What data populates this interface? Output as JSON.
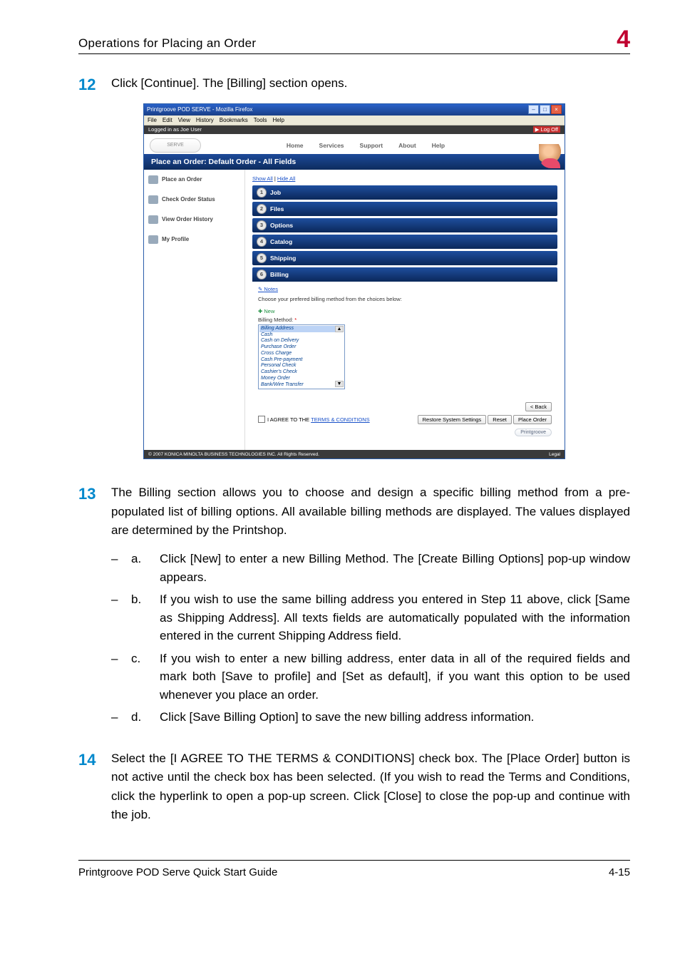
{
  "header": {
    "running_title": "Operations for Placing an Order",
    "chapter": "4"
  },
  "steps": [
    {
      "num": "12",
      "text": "Click [Continue]. The [Billing] section opens."
    },
    {
      "num": "13",
      "text": "The Billing section allows you to choose and design a specific billing method from a pre-populated list of billing options. All available billing methods are displayed. The values displayed are determined by the Printshop.",
      "subs": [
        {
          "letter": "a.",
          "text": "Click [New] to enter a new Billing Method. The [Create Billing Options] pop-up window appears."
        },
        {
          "letter": "b.",
          "text": "If you wish to use the same billing address you entered in Step 11 above, click [Same as Shipping Address]. All texts fields are automatically populated with the information entered in the current Shipping Address field."
        },
        {
          "letter": "c.",
          "text": "If you wish to enter a new billing address, enter data in all of the required fields and mark both [Save to profile] and [Set as default], if you want this option to be used whenever you place an order."
        },
        {
          "letter": "d.",
          "text": "Click [Save Billing Option] to save the new billing address information."
        }
      ]
    },
    {
      "num": "14",
      "text": "Select the [I AGREE TO THE TERMS & CONDITIONS] check box. The [Place Order] button is not active until the check box has been selected. (If you wish to read the Terms and Conditions, click the hyperlink to open a pop-up screen. Click [Close] to close the pop-up and continue with the job."
    }
  ],
  "screenshot": {
    "window_title": "Printgroove POD SERVE - Mozilla Firefox",
    "menubar": [
      "File",
      "Edit",
      "View",
      "History",
      "Bookmarks",
      "Tools",
      "Help"
    ],
    "logged_in": "Logged in as Joe User",
    "logoff": "Log Off",
    "topnav": [
      "Home",
      "Services",
      "Support",
      "About",
      "Help"
    ],
    "bluebar": "Place an Order: Default Order - All Fields",
    "leftnav": [
      "Place an Order",
      "Check Order Status",
      "View Order History",
      "My Profile"
    ],
    "showhide": {
      "show": "Show All",
      "hide": "Hide All",
      "sep": " | "
    },
    "sections": [
      {
        "n": "1",
        "label": "Job"
      },
      {
        "n": "2",
        "label": "Files"
      },
      {
        "n": "3",
        "label": "Options"
      },
      {
        "n": "4",
        "label": "Catalog"
      },
      {
        "n": "5",
        "label": "Shipping"
      },
      {
        "n": "6",
        "label": "Billing"
      }
    ],
    "billing": {
      "notes_link": "Notes",
      "instruction": "Choose your prefered billing method from the choices below:",
      "new_link": "New",
      "method_label": "Billing Method:",
      "required": "*",
      "options": [
        "Billing Address",
        "Cash",
        "Cash on Delivery",
        "Purchase Order",
        "Cross Charge",
        "Cash Pre-payment",
        "Personal Check",
        "Cashier's Check",
        "Money Order",
        "Bank/Wire Transfer"
      ]
    },
    "buttons": {
      "back": "< Back",
      "restore": "Restore System Settings",
      "reset": "Reset",
      "place": "Place Order"
    },
    "agree": {
      "prefix": "I AGREE TO THE ",
      "link": "TERMS & CONDITIONS"
    },
    "footer_copy": "© 2007 KONICA MINOLTA BUSINESS TECHNOLOGIES INC. All Rights Reserved.",
    "footer_legal": "Legal",
    "pg_logo": "Printgroove"
  },
  "footer": {
    "doc": "Printgroove POD Serve Quick Start Guide",
    "page": "4-15"
  }
}
